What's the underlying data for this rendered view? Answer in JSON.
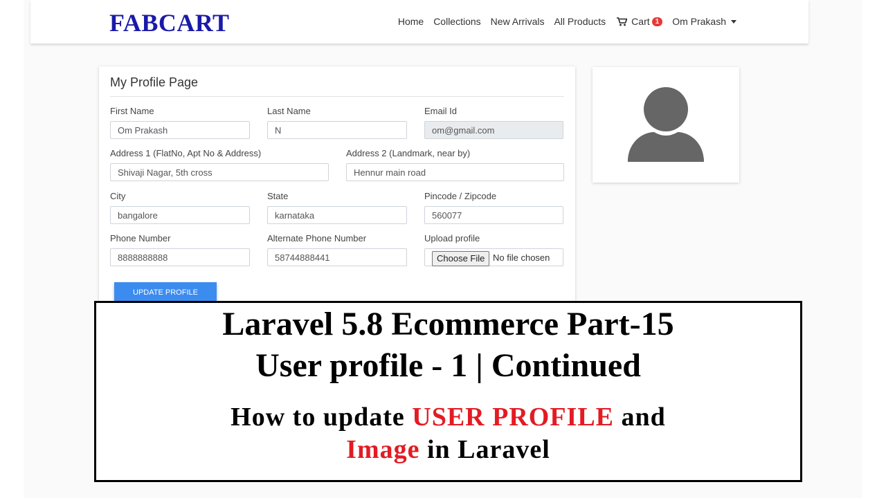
{
  "navbar": {
    "brand": "FABCART",
    "links": [
      "Home",
      "Collections",
      "New Arrivals",
      "All Products"
    ],
    "cart_label": "Cart",
    "cart_count": "1",
    "user_name": "Om Prakash"
  },
  "profile": {
    "title": "My Profile Page",
    "fields": {
      "first_name": {
        "label": "First Name",
        "value": "Om Prakash"
      },
      "last_name": {
        "label": "Last Name",
        "value": "N"
      },
      "email": {
        "label": "Email Id",
        "value": "om@gmail.com"
      },
      "address1": {
        "label": "Address 1 (FlatNo, Apt No & Address)",
        "value": "Shivaji Nagar, 5th cross"
      },
      "address2": {
        "label": "Address 2 (Landmark, near by)",
        "value": "Hennur main road"
      },
      "city": {
        "label": "City",
        "value": "bangalore"
      },
      "state": {
        "label": "State",
        "value": "karnataka"
      },
      "pincode": {
        "label": "Pincode / Zipcode",
        "value": "560077"
      },
      "phone": {
        "label": "Phone Number",
        "value": "8888888888"
      },
      "alt_phone": {
        "label": "Alternate Phone Number",
        "value": "58744888441"
      },
      "upload": {
        "label": "Upload profile",
        "button": "Choose File",
        "status": "No file chosen"
      }
    },
    "update_button": "UPDATE PROFILE"
  },
  "avatar": {
    "icon": "user-icon",
    "color": "#666666"
  },
  "overlay": {
    "line1": "Laravel 5.8 Ecommerce Part-15",
    "line2": "User profile - 1 | Continued",
    "line3_a": "How to update ",
    "line3_highlight": "USER PROFILE",
    "line3_b": " and",
    "line4_highlight": "Image",
    "line4_b": " in Laravel",
    "highlight_color": "#e31b23"
  }
}
